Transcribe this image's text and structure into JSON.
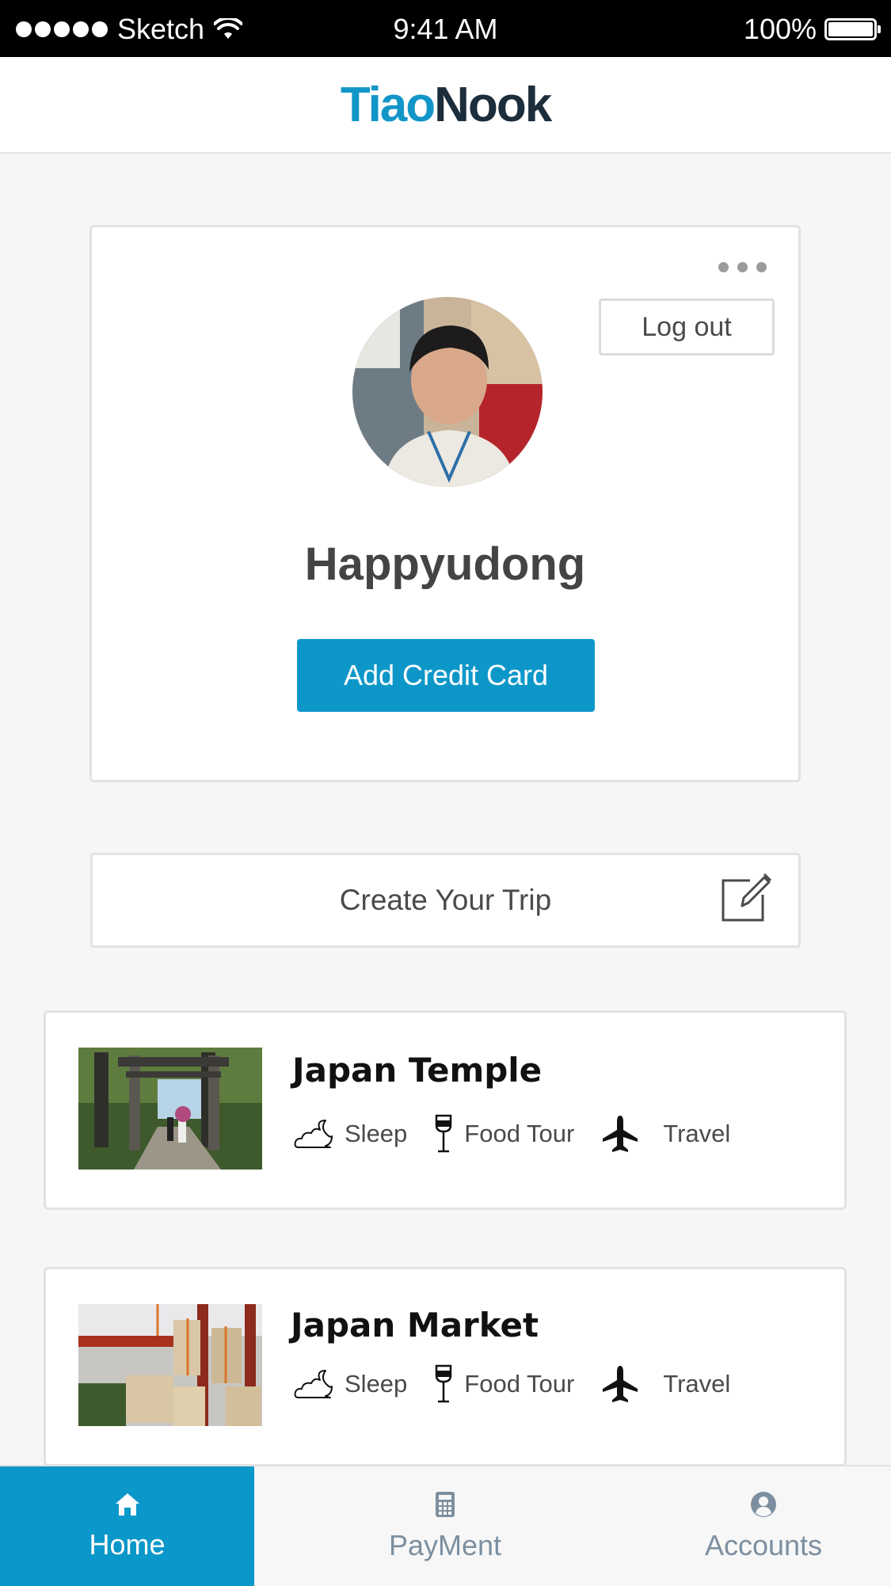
{
  "status_bar": {
    "carrier": "Sketch",
    "time": "9:41 AM",
    "battery": "100%"
  },
  "header": {
    "logo_part1": "Tiao",
    "logo_part2": "Nook"
  },
  "profile": {
    "username": "Happyudong",
    "logout_label": "Log out",
    "add_card_label": "Add Credit Card"
  },
  "create_trip": {
    "label": "Create Your Trip"
  },
  "trips": [
    {
      "title": "Japan Temple",
      "tags": [
        {
          "icon": "moon-cloud-icon",
          "label": "Sleep"
        },
        {
          "icon": "wine-glass-icon",
          "label": "Food Tour"
        },
        {
          "icon": "airplane-icon",
          "label": "Travel"
        }
      ]
    },
    {
      "title": "Japan Market",
      "tags": [
        {
          "icon": "moon-cloud-icon",
          "label": "Sleep"
        },
        {
          "icon": "wine-glass-icon",
          "label": "Food Tour"
        },
        {
          "icon": "airplane-icon",
          "label": "Travel"
        }
      ]
    }
  ],
  "tab_bar": {
    "tabs": [
      {
        "label": "Home",
        "icon": "home-icon",
        "active": true
      },
      {
        "label": "PayMent",
        "icon": "calculator-icon",
        "active": false
      },
      {
        "label": "Accounts",
        "icon": "user-icon",
        "active": false
      }
    ]
  },
  "colors": {
    "accent": "#0d97c9",
    "logo_dark": "#1c2d3c",
    "background": "#f6f6f6"
  }
}
